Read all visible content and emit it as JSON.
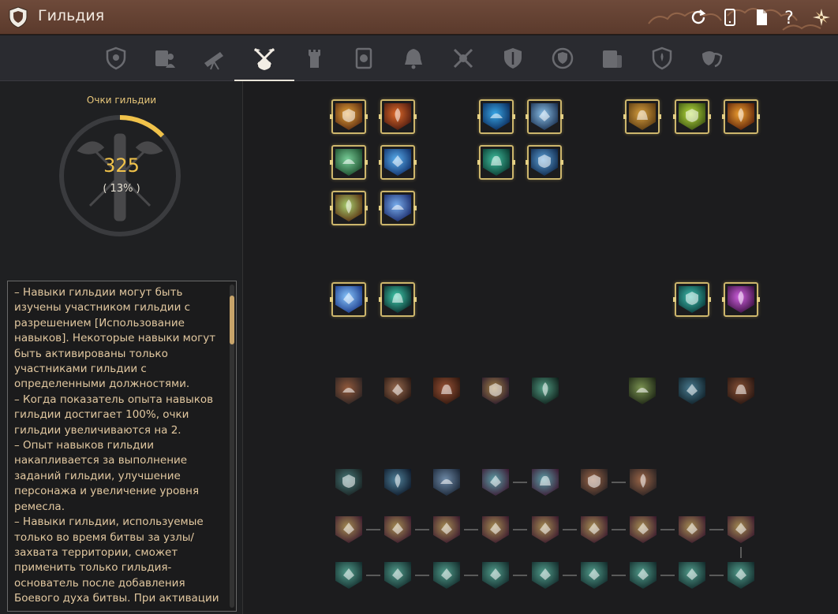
{
  "window": {
    "title": "Гильдия",
    "icons": [
      "shield-crest-icon",
      "refresh-icon",
      "phone-icon",
      "document-icon",
      "help-icon",
      "settings-compass-icon"
    ]
  },
  "tabs": [
    {
      "name": "tab-guild-info",
      "icon": "shield-crest-icon",
      "active": false
    },
    {
      "name": "tab-members",
      "icon": "members-scroll-icon",
      "active": false
    },
    {
      "name": "tab-telescope",
      "icon": "telescope-icon",
      "active": false
    },
    {
      "name": "tab-guild-skills",
      "icon": "crossed-axes-shield-icon",
      "active": true
    },
    {
      "name": "tab-tower",
      "icon": "tower-icon",
      "active": false
    },
    {
      "name": "tab-quests",
      "icon": "quest-scroll-icon",
      "active": false
    },
    {
      "name": "tab-alerts",
      "icon": "bell-icon",
      "active": false
    },
    {
      "name": "tab-war",
      "icon": "crossed-swords-icon",
      "active": false
    },
    {
      "name": "tab-defense",
      "icon": "shield-icon",
      "active": false
    },
    {
      "name": "tab-emblem",
      "icon": "emblem-ring-icon",
      "active": false
    },
    {
      "name": "tab-log",
      "icon": "log-scroll-icon",
      "active": false
    },
    {
      "name": "tab-alliance",
      "icon": "fleur-shield-icon",
      "active": false
    },
    {
      "name": "tab-masks",
      "icon": "masks-icon",
      "active": false
    }
  ],
  "left_panel": {
    "points_label": "Очки гильдии",
    "points_value": "325",
    "points_percent": "( 13% )",
    "progress": 0.13,
    "info_text": "– Навыки гильдии могут быть изучены участником гильдии с разрешением [Использование навыков]. Некоторые навыки могут быть активированы только участниками гильдии с определенными должностями.\n– Когда показатель опыта навыков гильдии достигает 100%, очки гильдии увеличиваются на 2.\n– Опыт навыков гильдии накапливается за выполнение заданий гильдии, улучшение персонажа и увеличение уровня ремесла.\n– Навыки гильдии, используемые только во время битвы за узлы/захвата территории, сможет применить только гильдия-основатель после добавления Боевого духа битвы. При активации"
  },
  "colors": {
    "title_bar": "#6e4a3a",
    "accent_gold": "#f0c24a",
    "frame_gold": "#cdb66c",
    "info_text": "#e2c8a0"
  },
  "skills": [
    {
      "name": "skill-golden-guard",
      "colors": [
        "#e8a53a",
        "#5a2a10"
      ],
      "learned": true
    },
    {
      "name": "skill-fire-rank",
      "colors": [
        "#e06a2a",
        "#4a1a10"
      ],
      "learned": true
    },
    {
      "name": "skill-ship",
      "colors": [
        "#3aa8e8",
        "#0a2a5a"
      ],
      "learned": true
    },
    {
      "name": "skill-fleet",
      "colors": [
        "#8ac0e8",
        "#1a3050"
      ],
      "learned": true
    },
    {
      "name": "skill-hand",
      "colors": [
        "#d8a040",
        "#5a3a10"
      ],
      "learned": true
    },
    {
      "name": "skill-green-body",
      "colors": [
        "#b8e040",
        "#3a5010"
      ],
      "learned": true
    },
    {
      "name": "skill-flame-hand",
      "colors": [
        "#f0a030",
        "#5a2008"
      ],
      "learned": true
    },
    {
      "name": "skill-green-giant-plus",
      "colors": [
        "#7ad09a",
        "#1a4a2a"
      ],
      "learned": true
    },
    {
      "name": "skill-blue-giant-plus",
      "colors": [
        "#5ab0f0",
        "#10306a"
      ],
      "learned": true
    },
    {
      "name": "skill-target",
      "colors": [
        "#40c0a0",
        "#0a3a30"
      ],
      "learned": true
    },
    {
      "name": "skill-galleon",
      "colors": [
        "#5aa0d8",
        "#10284a"
      ],
      "learned": true
    },
    {
      "name": "skill-green-claw",
      "colors": [
        "#a8d070",
        "#5a3010"
      ],
      "learned": true
    },
    {
      "name": "skill-blue-claw",
      "colors": [
        "#7ab0f0",
        "#1a2a6a"
      ],
      "learned": true
    },
    {
      "name": "skill-wing",
      "colors": [
        "#8ac8ff",
        "#1a3a8a"
      ],
      "learned": true
    },
    {
      "name": "skill-dark-body",
      "colors": [
        "#40d0b0",
        "#0a2a2a"
      ],
      "learned": true
    },
    {
      "name": "skill-teal-emblem",
      "colors": [
        "#40c0b0",
        "#0a3a3a"
      ],
      "learned": true
    },
    {
      "name": "skill-lightning",
      "colors": [
        "#d060e0",
        "#3a1040"
      ],
      "learned": true
    },
    {
      "name": "skill-fire-wings",
      "colors": [
        "#d86a30",
        "#3a2a2a"
      ],
      "learned": false
    },
    {
      "name": "skill-blade",
      "colors": [
        "#d8804a",
        "#3a1a10"
      ],
      "learned": false
    },
    {
      "name": "skill-flame",
      "colors": [
        "#e8602a",
        "#4a1a08"
      ],
      "learned": false
    },
    {
      "name": "skill-spiral",
      "colors": [
        "#e0a030",
        "#3a1a40"
      ],
      "learned": false
    },
    {
      "name": "skill-teal-slash",
      "colors": [
        "#40d0a0",
        "#0a2a20"
      ],
      "learned": false
    },
    {
      "name": "skill-leaf",
      "colors": [
        "#90c040",
        "#203010"
      ],
      "learned": false
    },
    {
      "name": "skill-orb",
      "colors": [
        "#40a0c8",
        "#0a2a3a"
      ],
      "learned": false
    },
    {
      "name": "skill-wheel",
      "colors": [
        "#c8602a",
        "#3a1810"
      ],
      "learned": false
    },
    {
      "name": "skill-gear",
      "colors": [
        "#40a0a0",
        "#1a2a2a"
      ],
      "learned": false
    },
    {
      "name": "skill-blue-spirit",
      "colors": [
        "#4aa8d8",
        "#0a2040"
      ],
      "learned": false
    },
    {
      "name": "skill-tools",
      "colors": [
        "#7ab0e8",
        "#1a3050"
      ],
      "learned": false
    },
    {
      "name": "skill-seahorse-1",
      "colors": [
        "#50d0e0",
        "#5a1a4a"
      ],
      "learned": false
    },
    {
      "name": "skill-seahorse-2",
      "colors": [
        "#50d0e0",
        "#5a1a4a"
      ],
      "learned": false
    },
    {
      "name": "skill-hand-strike-1",
      "colors": [
        "#e07a40",
        "#3a2a2a"
      ],
      "learned": false
    },
    {
      "name": "skill-hand-strike-2",
      "colors": [
        "#e07a40",
        "#3a2a2a"
      ],
      "learned": false
    },
    {
      "name": "skill-chest-gold",
      "colors": [
        "#e0b040",
        "#5a1a40"
      ],
      "learned": false
    },
    {
      "name": "skill-chest-teal",
      "colors": [
        "#40d0b0",
        "#0a3a3a"
      ],
      "learned": false
    }
  ]
}
